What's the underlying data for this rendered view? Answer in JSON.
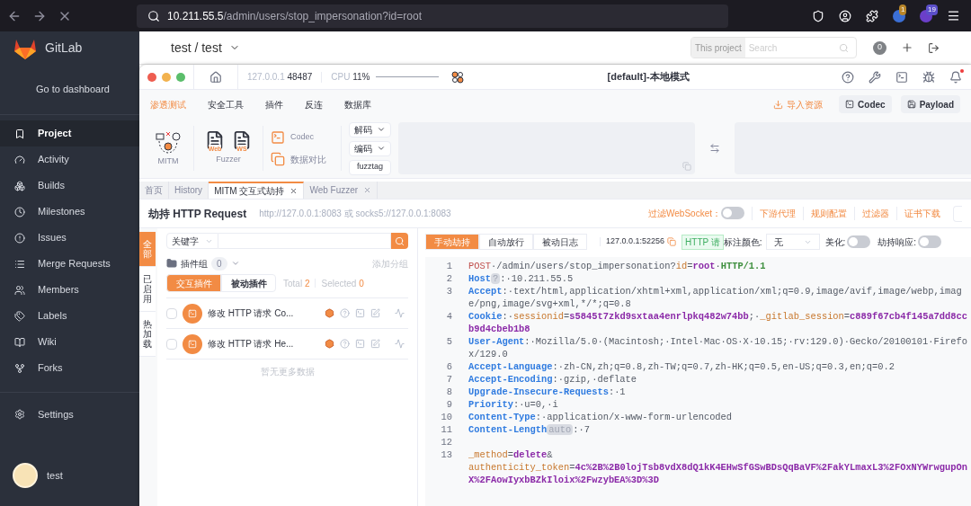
{
  "browser": {
    "url_host": "10.211.55.5",
    "url_path": "/admin/users/stop_impersonation?id=root",
    "badges": [
      "1",
      "19"
    ]
  },
  "gitlab": {
    "brand": "GitLab",
    "dashboard_link": "Go to dashboard",
    "nav": [
      {
        "label": "Project",
        "selected": true
      },
      {
        "label": "Activity",
        "selected": false
      },
      {
        "label": "Builds",
        "selected": false
      },
      {
        "label": "Milestones",
        "selected": false
      },
      {
        "label": "Issues",
        "selected": false
      },
      {
        "label": "Merge Requests",
        "selected": false
      },
      {
        "label": "Members",
        "selected": false
      },
      {
        "label": "Labels",
        "selected": false
      },
      {
        "label": "Wiki",
        "selected": false
      },
      {
        "label": "Forks",
        "selected": false
      }
    ],
    "settings": "Settings",
    "user": "test",
    "breadcrumb": "test / test",
    "search": {
      "scope": "This project",
      "placeholder": "Search"
    },
    "counter": "0"
  },
  "yakit": {
    "engine": {
      "host": "127.0.0.1",
      "port": "48487"
    },
    "cpu": {
      "label": "CPU",
      "value": "11%"
    },
    "title": "[default]-本地模式",
    "menu": [
      {
        "label": "渗透测试",
        "selected": true
      },
      {
        "label": "安全工具",
        "selected": false
      },
      {
        "label": "插件",
        "selected": false
      },
      {
        "label": "反连",
        "selected": false
      },
      {
        "label": "数据库",
        "selected": false
      }
    ],
    "import": "导入资源",
    "top_buttons": [
      "Codec",
      "Payload"
    ],
    "tools": {
      "mitm": "MITM",
      "fuzzer": "Fuzzer",
      "web": "Web",
      "ws": "WS",
      "codec": "Codec",
      "compare": "数据对比",
      "decode": "解码",
      "encode": "编码",
      "fuzztag": "fuzztag"
    },
    "tabs": [
      {
        "label": "首页",
        "selected": false,
        "closable": false
      },
      {
        "label": "History",
        "selected": false,
        "closable": false
      },
      {
        "label": "MITM 交互式劫持",
        "selected": true,
        "closable": true
      },
      {
        "label": "Web Fuzzer",
        "selected": false,
        "closable": true
      }
    ],
    "page": {
      "title": "劫持 HTTP Request",
      "proxy": "http://127.0.0.1:8083 或 socks5://127.0.0.1:8083",
      "filter_ws": {
        "label": "过滤WebSocket：",
        "on": false
      },
      "links": [
        "下游代理",
        "规则配置",
        "过滤器",
        "证书下载"
      ]
    },
    "side_tabs": [
      {
        "label": "全部",
        "selected": true
      },
      {
        "label": "已启用",
        "selected": false
      },
      {
        "label": "热加载",
        "selected": false
      }
    ],
    "plugins": {
      "search_type": "关键字",
      "group_label": "插件组",
      "group_count": "0",
      "add_group": "添加分组",
      "subtabs": [
        {
          "label": "交互插件",
          "selected": true
        },
        {
          "label": "被动插件",
          "selected": false
        }
      ],
      "total_label": "Total",
      "total": "2",
      "selected_label": "Selected",
      "selected": "0",
      "rows": [
        {
          "name": "修改 HTTP 请求 Co...",
          "checked": false
        },
        {
          "name": "修改 HTTP 请求 He...",
          "checked": false
        }
      ],
      "empty": "暂无更多数据"
    },
    "editor": {
      "modes": [
        {
          "label": "手动劫持",
          "selected": true
        },
        {
          "label": "自动放行",
          "selected": false
        },
        {
          "label": "被动日志",
          "selected": false
        }
      ],
      "address": "127.0.0.1:52256",
      "tag": "HTTP 请",
      "color_label": "标注颜色:",
      "color_value": "无",
      "beautify": {
        "label": "美化:",
        "on": false
      },
      "hijack_response": {
        "label": "劫持响应:",
        "on": false
      },
      "lines": [
        {
          "number": "1",
          "segments": [
            {
              "kind": "method",
              "text": "POST"
            },
            {
              "kind": "plain",
              "text": "·/admin/users/stop_impersonation?"
            },
            {
              "kind": "param",
              "text": "id"
            },
            {
              "kind": "plain",
              "text": "="
            },
            {
              "kind": "value",
              "text": "root"
            },
            {
              "kind": "plain",
              "text": "·"
            },
            {
              "kind": "proto",
              "text": "HTTP/1.1"
            }
          ]
        },
        {
          "number": "2",
          "segments": [
            {
              "kind": "key",
              "text": "Host"
            },
            {
              "kind": "badge",
              "text": "?"
            },
            {
              "kind": "plain",
              "text": ":·10.211.55.5"
            }
          ]
        },
        {
          "number": "3",
          "segments": [
            {
              "kind": "key",
              "text": "Accept"
            },
            {
              "kind": "plain",
              "text": ":·text/html,application/xhtml+xml,application/xml;q=0.9,image/avif,image/webp,image/png,image/svg+xml,*/*;q=0.8"
            }
          ]
        },
        {
          "number": "4",
          "segments": [
            {
              "kind": "key",
              "text": "Cookie"
            },
            {
              "kind": "plain",
              "text": ":·"
            },
            {
              "kind": "param",
              "text": "sessionid"
            },
            {
              "kind": "plain",
              "text": "="
            },
            {
              "kind": "value",
              "text": "s5845t7zkd9sxtaa4enrlpkq482w74bb"
            },
            {
              "kind": "plain",
              "text": ";·"
            },
            {
              "kind": "param",
              "text": "_gitlab_session"
            },
            {
              "kind": "plain",
              "text": "="
            },
            {
              "kind": "value",
              "text": "c889f67cb4f145a7dd8ccb9d4cbeb1b8"
            }
          ]
        },
        {
          "number": "5",
          "segments": [
            {
              "kind": "key",
              "text": "User-Agent"
            },
            {
              "kind": "plain",
              "text": ":·Mozilla/5.0·(Macintosh;·Intel·Mac·OS·X·10.15;·rv:129.0)·Gecko/20100101·Firefox/129.0"
            }
          ]
        },
        {
          "number": "6",
          "segments": [
            {
              "kind": "key",
              "text": "Accept-Language"
            },
            {
              "kind": "plain",
              "text": ":·zh-CN,zh;q=0.8,zh-TW;q=0.7,zh-HK;q=0.5,en-US;q=0.3,en;q=0.2"
            }
          ]
        },
        {
          "number": "7",
          "segments": [
            {
              "kind": "key",
              "text": "Accept-Encoding"
            },
            {
              "kind": "plain",
              "text": ":·gzip,·deflate"
            }
          ]
        },
        {
          "number": "8",
          "segments": [
            {
              "kind": "key",
              "text": "Upgrade-Insecure-Requests"
            },
            {
              "kind": "plain",
              "text": ":·1"
            }
          ]
        },
        {
          "number": "9",
          "segments": [
            {
              "kind": "key",
              "text": "Priority"
            },
            {
              "kind": "plain",
              "text": ":·u=0,·i"
            }
          ]
        },
        {
          "number": "10",
          "segments": [
            {
              "kind": "key",
              "text": "Content-Type"
            },
            {
              "kind": "plain",
              "text": ":·application/x-www-form-urlencoded"
            }
          ]
        },
        {
          "number": "11",
          "segments": [
            {
              "kind": "key",
              "text": "Content-Length"
            },
            {
              "kind": "badge",
              "text": "auto"
            },
            {
              "kind": "plain",
              "text": ":·7"
            }
          ]
        },
        {
          "number": "12"
        },
        {
          "number": "13",
          "segments": [
            {
              "kind": "param",
              "text": "_method"
            },
            {
              "kind": "plain",
              "text": "="
            },
            {
              "kind": "value",
              "text": "delete"
            },
            {
              "kind": "plain",
              "text": "&"
            },
            {
              "kind": "break"
            },
            {
              "kind": "param",
              "text": "authenticity_token"
            },
            {
              "kind": "plain",
              "text": "="
            },
            {
              "kind": "value",
              "text": "4c%2B%2B0lojTsb8vdX8dQ1kK4EHwSfGSwBDsQqBaVF%2FakYLmaxL3%2FOxNYWrwgupOnX%2FAowIyxbBZkIloix%2FwzybEA%3D%3D"
            }
          ]
        }
      ]
    }
  }
}
